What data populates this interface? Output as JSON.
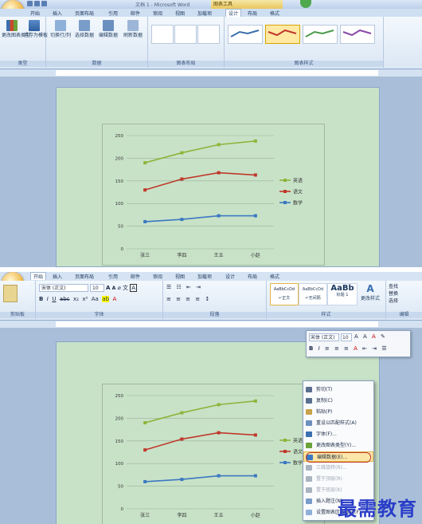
{
  "top": {
    "window_title": "文档 1 - Microsoft Word",
    "context_tools": "图表工具",
    "tabs": [
      "开始",
      "插入",
      "页面布局",
      "引用",
      "邮件",
      "审阅",
      "视图",
      "加载项",
      "设计",
      "布局",
      "格式"
    ],
    "active_tab": "设计",
    "groups": {
      "type": {
        "label": "类型",
        "buttons": [
          "更改图表类型",
          "另存为模板"
        ]
      },
      "data": {
        "label": "数据",
        "buttons": [
          "切换行/列",
          "选择数据",
          "编辑数据",
          "刷新数据"
        ]
      },
      "layout": {
        "label": "图表布局"
      },
      "styles": {
        "label": "图表样式"
      }
    }
  },
  "bottom": {
    "tabs": [
      "开始",
      "插入",
      "页面布局",
      "引用",
      "邮件",
      "审阅",
      "视图",
      "加载项",
      "设计",
      "布局",
      "格式"
    ],
    "active_tab": "开始",
    "font_name": "宋体 (正文)",
    "font_size": "10",
    "group_labels": [
      "剪贴板",
      "字体",
      "段落",
      "样式",
      "编辑"
    ],
    "styles": [
      {
        "preview": "AaBbCcDd",
        "name": "↵正文"
      },
      {
        "preview": "AaBbCcDd",
        "name": "↵无间隔"
      },
      {
        "preview": "AaBb",
        "name": "标题 1"
      }
    ],
    "change_styles": "更改样式",
    "edit_items": [
      "查找",
      "替换",
      "选择"
    ],
    "mini_toolbar": {
      "font": "宋体 (正文)",
      "size": "10"
    },
    "context_menu": [
      {
        "label": "剪切(T)",
        "icon": "scissors-icon",
        "disabled": false
      },
      {
        "label": "复制(C)",
        "icon": "copy-icon",
        "disabled": false
      },
      {
        "label": "粘贴(P)",
        "icon": "paste-icon",
        "disabled": false
      },
      {
        "label": "重设以匹配样式(A)",
        "icon": "reset-icon",
        "disabled": false
      },
      {
        "label": "字体(F)...",
        "icon": "font-icon",
        "disabled": false
      },
      {
        "label": "更改图表类型(Y)...",
        "icon": "chart-type-icon",
        "disabled": false
      },
      {
        "label": "编辑数据(E)...",
        "icon": "edit-data-icon",
        "disabled": false,
        "highlighted": true
      },
      {
        "label": "三维旋转(R)...",
        "icon": "rotate-icon",
        "disabled": true
      },
      {
        "label": "置于顶层(R)",
        "icon": "front-icon",
        "disabled": true
      },
      {
        "label": "置于底层(K)",
        "icon": "back-icon",
        "disabled": true
      },
      {
        "label": "插入题注(N)...",
        "icon": "caption-icon",
        "disabled": false
      },
      {
        "label": "设置图表区域格式(F)...",
        "icon": "format-icon",
        "disabled": false
      }
    ]
  },
  "chart_data": {
    "type": "line",
    "categories": [
      "张三",
      "李四",
      "王五",
      "小赵"
    ],
    "series": [
      {
        "name": "英语",
        "values": [
          190,
          212,
          230,
          238
        ],
        "color": "#8db53b"
      },
      {
        "name": "语文",
        "values": [
          130,
          154,
          168,
          163
        ],
        "color": "#c0392b"
      },
      {
        "name": "数学",
        "values": [
          60,
          65,
          73,
          73
        ],
        "color": "#3b78c2"
      }
    ],
    "ylim": [
      0,
      250
    ],
    "yticks": [
      0,
      50,
      100,
      150,
      200,
      250
    ],
    "grid": true,
    "legend": "right"
  },
  "watermark": "最需教育"
}
